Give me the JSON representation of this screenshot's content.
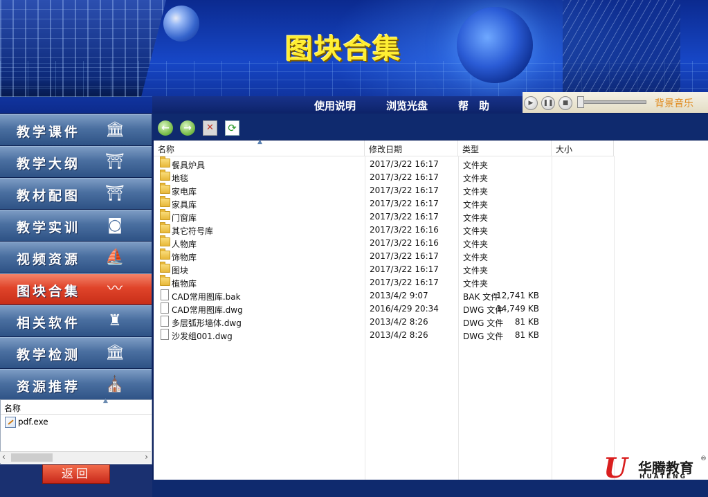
{
  "banner": {
    "title": "图块合集"
  },
  "menu": {
    "items": [
      "使用说明",
      "浏览光盘",
      "帮　助"
    ]
  },
  "player": {
    "label": "背景音乐",
    "play_icon": "play-icon",
    "pause_icon": "pause-icon",
    "stop_icon": "stop-icon"
  },
  "sidebar": {
    "items": [
      {
        "label": "教学课件",
        "icon": "building-icon",
        "active": false
      },
      {
        "label": "教学大纲",
        "icon": "pagoda-icon",
        "active": false
      },
      {
        "label": "教材配图",
        "icon": "temple-icon",
        "active": false
      },
      {
        "label": "教学实训",
        "icon": "stadium-icon",
        "active": false
      },
      {
        "label": "视频资源",
        "icon": "opera-house-icon",
        "active": false
      },
      {
        "label": "图块合集",
        "icon": "wave-icon",
        "active": true
      },
      {
        "label": "相关软件",
        "icon": "castle-icon",
        "active": false
      },
      {
        "label": "教学检测",
        "icon": "capitol-icon",
        "active": false
      },
      {
        "label": "资源推荐",
        "icon": "cathedral-icon",
        "active": false
      }
    ]
  },
  "side_panel": {
    "header": "名称",
    "item": "pdf.exe"
  },
  "back_button": "返回",
  "toolbar": {
    "back_icon": "back-arrow-icon",
    "forward_icon": "forward-arrow-icon",
    "delete_icon": "delete-icon",
    "refresh_icon": "refresh-icon"
  },
  "files": {
    "columns": [
      "名称",
      "修改日期",
      "类型",
      "大小"
    ],
    "rows": [
      {
        "name": "餐具炉具",
        "date": "2017/3/22 16:17",
        "type": "文件夹",
        "size": "",
        "kind": "folder"
      },
      {
        "name": "地毯",
        "date": "2017/3/22 16:17",
        "type": "文件夹",
        "size": "",
        "kind": "folder"
      },
      {
        "name": "家电库",
        "date": "2017/3/22 16:17",
        "type": "文件夹",
        "size": "",
        "kind": "folder"
      },
      {
        "name": "家具库",
        "date": "2017/3/22 16:17",
        "type": "文件夹",
        "size": "",
        "kind": "folder"
      },
      {
        "name": "门窗库",
        "date": "2017/3/22 16:17",
        "type": "文件夹",
        "size": "",
        "kind": "folder"
      },
      {
        "name": "其它符号库",
        "date": "2017/3/22 16:16",
        "type": "文件夹",
        "size": "",
        "kind": "folder"
      },
      {
        "name": "人物库",
        "date": "2017/3/22 16:16",
        "type": "文件夹",
        "size": "",
        "kind": "folder"
      },
      {
        "name": "饰物库",
        "date": "2017/3/22 16:17",
        "type": "文件夹",
        "size": "",
        "kind": "folder"
      },
      {
        "name": "图块",
        "date": "2017/3/22 16:17",
        "type": "文件夹",
        "size": "",
        "kind": "folder"
      },
      {
        "name": "植物库",
        "date": "2017/3/22 16:17",
        "type": "文件夹",
        "size": "",
        "kind": "folder"
      },
      {
        "name": "CAD常用图库.bak",
        "date": "2013/4/2 9:07",
        "type": "BAK 文件",
        "size": "12,741 KB",
        "kind": "file"
      },
      {
        "name": "CAD常用图库.dwg",
        "date": "2016/4/29 20:34",
        "type": "DWG 文件",
        "size": "14,749 KB",
        "kind": "file"
      },
      {
        "name": "多层弧形墙体.dwg",
        "date": "2013/4/2 8:26",
        "type": "DWG 文件",
        "size": "81 KB",
        "kind": "file"
      },
      {
        "name": "沙发组001.dwg",
        "date": "2013/4/2 8:26",
        "type": "DWG 文件",
        "size": "81 KB",
        "kind": "file"
      }
    ]
  },
  "logo": {
    "cn": "华腾教育",
    "en": "HUATENG",
    "reg": "®"
  }
}
